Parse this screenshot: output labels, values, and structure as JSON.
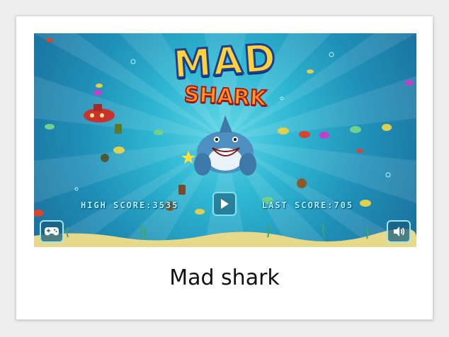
{
  "game": {
    "logo_line1": "MAD",
    "logo_line2": "SHARK",
    "high_score_label": "HIGH SCORE:",
    "high_score_value": "3535",
    "last_score_label": "LAST SCORE:",
    "last_score_value": "705",
    "play_icon": "play-icon",
    "controller_icon": "gamepad-icon",
    "sound_icon": "speaker-icon"
  },
  "card": {
    "title": "Mad shark"
  },
  "colors": {
    "water_light": "#5fd6e6",
    "water_dark": "#1a6f9c",
    "logo_yellow": "#ffd23a",
    "logo_orange": "#ff9b1f",
    "score_text": "#a9f4ff"
  }
}
